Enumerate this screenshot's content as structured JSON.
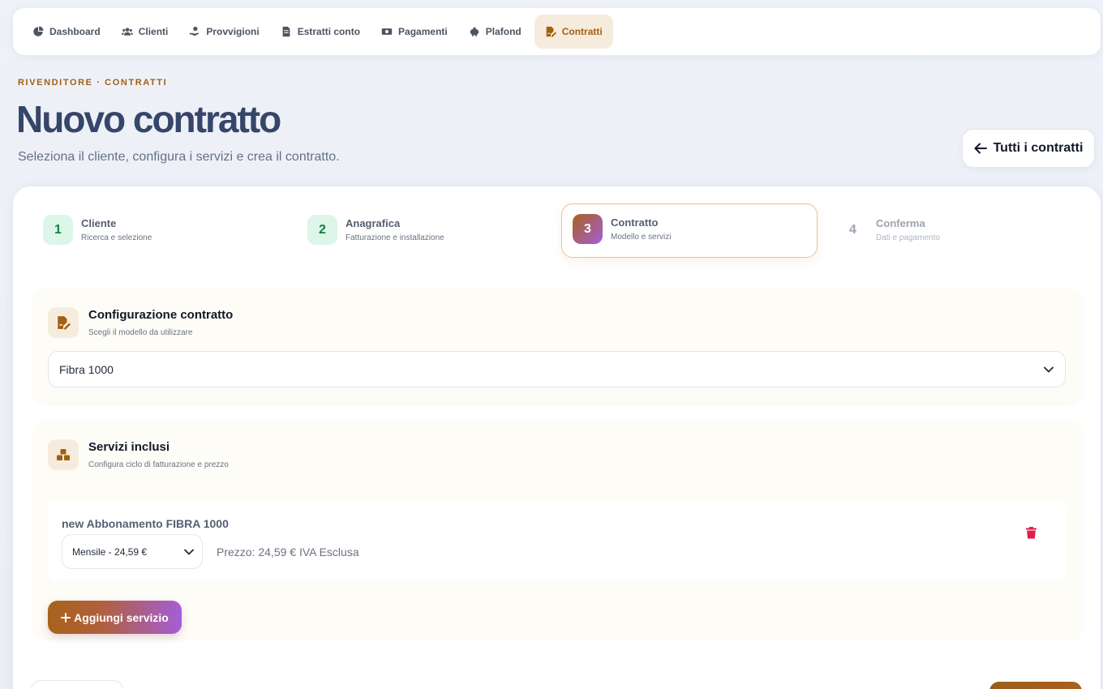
{
  "nav": {
    "items": [
      {
        "label": "Dashboard",
        "icon": "pie-chart-icon"
      },
      {
        "label": "Clienti",
        "icon": "users-icon"
      },
      {
        "label": "Provvigioni",
        "icon": "hand-coin-icon"
      },
      {
        "label": "Estratti conto",
        "icon": "file-invoice-icon"
      },
      {
        "label": "Pagamenti",
        "icon": "money-bill-icon"
      },
      {
        "label": "Plafond",
        "icon": "piggy-bank-icon"
      },
      {
        "label": "Contratti",
        "icon": "file-signature-icon",
        "active": true
      }
    ]
  },
  "header": {
    "eyebrow": "RIVENDITORE · CONTRATTI",
    "title": "Nuovo contratto",
    "subtitle": "Seleziona il cliente, configura i servizi e crea il contratto.",
    "back_label": "Tutti i contratti"
  },
  "steps": [
    {
      "num": "1",
      "title": "Cliente",
      "desc": "Ricerca e selezione",
      "state": "done"
    },
    {
      "num": "2",
      "title": "Anagrafica",
      "desc": "Fatturazione e installazione",
      "state": "done"
    },
    {
      "num": "3",
      "title": "Contratto",
      "desc": "Modello e servizi",
      "state": "current"
    },
    {
      "num": "4",
      "title": "Conferma",
      "desc": "Dati e pagamento",
      "state": "future"
    }
  ],
  "config": {
    "title": "Configurazione contratto",
    "subtitle": "Scegli il modello da utilizzare",
    "model_value": "Fibra 1000"
  },
  "services": {
    "title": "Servizi inclusi",
    "subtitle": "Configura ciclo di fatturazione e prezzo",
    "items": [
      {
        "name": "new Abbonamento FIBRA 1000",
        "cycle": "Mensile - 24,59 €",
        "price": "Prezzo: 24,59 € IVA Esclusa"
      }
    ],
    "add_label": "Aggiungi servizio"
  },
  "colors": {
    "accent": "#a35f12",
    "gradient_start": "#a8621c",
    "gradient_end": "#a55dd8",
    "success": "#15803d",
    "danger": "#e11d48"
  }
}
